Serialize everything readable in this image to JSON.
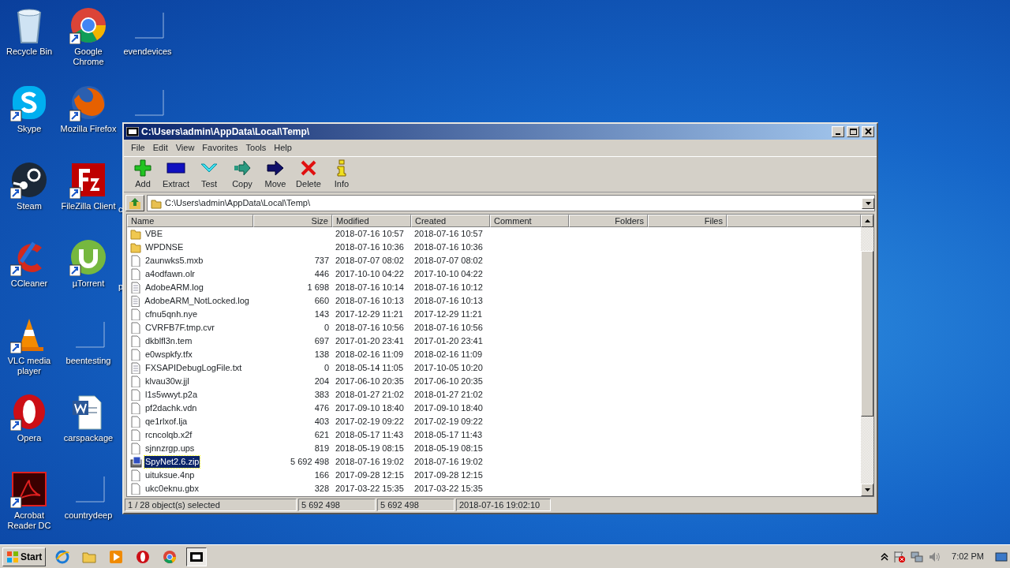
{
  "desktop": {
    "columns": [
      [
        {
          "kind": "recycle",
          "label": "Recycle Bin",
          "shortcut": false
        },
        {
          "kind": "skype",
          "label": "Skype",
          "shortcut": true
        },
        {
          "kind": "steam",
          "label": "Steam",
          "shortcut": true
        },
        {
          "kind": "ccleaner",
          "label": "CCleaner",
          "shortcut": true
        },
        {
          "kind": "vlc",
          "label": "VLC media player",
          "shortcut": true
        },
        {
          "kind": "opera",
          "label": "Opera",
          "shortcut": true
        },
        {
          "kind": "acrobat",
          "label": "Acrobat Reader DC",
          "shortcut": true
        }
      ],
      [
        {
          "kind": "chrome",
          "label": "Google Chrome",
          "shortcut": true
        },
        {
          "kind": "firefox",
          "label": "Mozilla Firefox",
          "shortcut": true
        },
        {
          "kind": "filezilla",
          "label": "FileZilla Client",
          "shortcut": true
        },
        {
          "kind": "utorrent",
          "label": "µTorrent",
          "shortcut": true
        },
        {
          "kind": "blank",
          "label": "beentesting",
          "shortcut": false
        },
        {
          "kind": "word",
          "label": "carspackage",
          "shortcut": false
        },
        {
          "kind": "blank",
          "label": "countrydeep",
          "shortcut": false
        }
      ],
      [
        {
          "kind": "blank",
          "label": "evendevices",
          "shortcut": false
        },
        {
          "kind": "blank",
          "shortcut": false
        },
        {
          "kind": "covered",
          "label": "c"
        },
        {
          "kind": "covered",
          "label": "p"
        }
      ]
    ]
  },
  "window": {
    "title": "C:\\Users\\admin\\AppData\\Local\\Temp\\",
    "menu": [
      "File",
      "Edit",
      "View",
      "Favorites",
      "Tools",
      "Help"
    ],
    "toolbar": [
      {
        "kind": "add",
        "label": "Add"
      },
      {
        "kind": "extract",
        "label": "Extract"
      },
      {
        "kind": "test",
        "label": "Test"
      },
      {
        "kind": "copy",
        "label": "Copy"
      },
      {
        "kind": "move",
        "label": "Move"
      },
      {
        "kind": "delete",
        "label": "Delete"
      },
      {
        "kind": "info",
        "label": "Info"
      }
    ],
    "address": "C:\\Users\\admin\\AppData\\Local\\Temp\\",
    "columns": [
      "Name",
      "Size",
      "Modified",
      "Created",
      "Comment",
      "Folders",
      "Files"
    ],
    "rows": [
      {
        "kind": "folder",
        "name": "VBE",
        "size": "",
        "modified": "2018-07-16 10:57",
        "created": "2018-07-16 10:57",
        "selected": false
      },
      {
        "kind": "folder",
        "name": "WPDNSE",
        "size": "",
        "modified": "2018-07-16 10:36",
        "created": "2018-07-16 10:36",
        "selected": false
      },
      {
        "kind": "file",
        "name": "2aunwks5.mxb",
        "size": "737",
        "modified": "2018-07-07 08:02",
        "created": "2018-07-07 08:02",
        "selected": false
      },
      {
        "kind": "file",
        "name": "a4odfawn.olr",
        "size": "446",
        "modified": "2017-10-10 04:22",
        "created": "2017-10-10 04:22",
        "selected": false
      },
      {
        "kind": "text",
        "name": "AdobeARM.log",
        "size": "1 698",
        "modified": "2018-07-16 10:14",
        "created": "2018-07-16 10:12",
        "selected": false
      },
      {
        "kind": "text",
        "name": "AdobeARM_NotLocked.log",
        "size": "660",
        "modified": "2018-07-16 10:13",
        "created": "2018-07-16 10:13",
        "selected": false
      },
      {
        "kind": "file",
        "name": "cfnu5qnh.nye",
        "size": "143",
        "modified": "2017-12-29 11:21",
        "created": "2017-12-29 11:21",
        "selected": false
      },
      {
        "kind": "file",
        "name": "CVRFB7F.tmp.cvr",
        "size": "0",
        "modified": "2018-07-16 10:56",
        "created": "2018-07-16 10:56",
        "selected": false
      },
      {
        "kind": "file",
        "name": "dkblfl3n.tem",
        "size": "697",
        "modified": "2017-01-20 23:41",
        "created": "2017-01-20 23:41",
        "selected": false
      },
      {
        "kind": "file",
        "name": "e0wspkfy.tfx",
        "size": "138",
        "modified": "2018-02-16 11:09",
        "created": "2018-02-16 11:09",
        "selected": false
      },
      {
        "kind": "text",
        "name": "FXSAPIDebugLogFile.txt",
        "size": "0",
        "modified": "2018-05-14 11:05",
        "created": "2017-10-05 10:20",
        "selected": false
      },
      {
        "kind": "file",
        "name": "klvau30w.jjl",
        "size": "204",
        "modified": "2017-06-10 20:35",
        "created": "2017-06-10 20:35",
        "selected": false
      },
      {
        "kind": "file",
        "name": "l1s5wwyt.p2a",
        "size": "383",
        "modified": "2018-01-27 21:02",
        "created": "2018-01-27 21:02",
        "selected": false
      },
      {
        "kind": "file",
        "name": "pf2dachk.vdn",
        "size": "476",
        "modified": "2017-09-10 18:40",
        "created": "2017-09-10 18:40",
        "selected": false
      },
      {
        "kind": "file",
        "name": "qe1rlxof.lja",
        "size": "403",
        "modified": "2017-02-19 09:22",
        "created": "2017-02-19 09:22",
        "selected": false
      },
      {
        "kind": "file",
        "name": "rcncolqb.x2f",
        "size": "621",
        "modified": "2018-05-17 11:43",
        "created": "2018-05-17 11:43",
        "selected": false
      },
      {
        "kind": "file",
        "name": "sjnnzrgp.ups",
        "size": "819",
        "modified": "2018-05-19 08:15",
        "created": "2018-05-19 08:15",
        "selected": false
      },
      {
        "kind": "archive",
        "name": "SpyNet2.6.zip",
        "size": "5 692 498",
        "modified": "2018-07-16 19:02",
        "created": "2018-07-16 19:02",
        "selected": true
      },
      {
        "kind": "file",
        "name": "uituksue.4np",
        "size": "166",
        "modified": "2017-09-28 12:15",
        "created": "2017-09-28 12:15",
        "selected": false
      },
      {
        "kind": "file",
        "name": "ukc0eknu.gbx",
        "size": "328",
        "modified": "2017-03-22 15:35",
        "created": "2017-03-22 15:35",
        "selected": false
      }
    ],
    "status_bar": [
      "1 / 28 object(s) selected",
      "5 692 498",
      "5 692 498",
      "2018-07-16 19:02:10"
    ]
  },
  "taskbar": {
    "start": "Start",
    "apps": [
      {
        "kind": "ie",
        "active": false
      },
      {
        "kind": "explorer",
        "active": false
      },
      {
        "kind": "media",
        "active": false
      },
      {
        "kind": "opera",
        "active": false
      },
      {
        "kind": "chrome",
        "active": false
      },
      {
        "kind": "sevenzip",
        "active": true
      }
    ],
    "clock": "7:02 PM"
  }
}
